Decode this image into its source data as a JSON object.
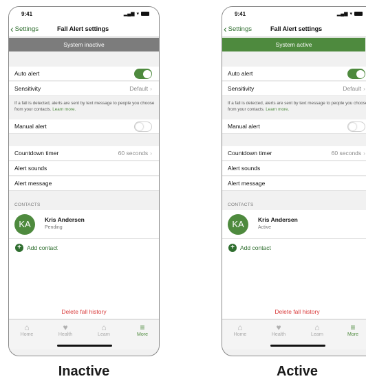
{
  "colors": {
    "accent": "#4e8a3e",
    "inactive_banner": "#7c7c7c",
    "danger": "#d93a3a"
  },
  "screens": [
    {
      "caption": "Inactive",
      "status_bar": {
        "time": "9:41",
        "signal": "▂▄▆",
        "wifi": "▾"
      },
      "nav": {
        "back_label": "Settings",
        "title": "Fall Alert settings"
      },
      "banner": {
        "text": "System inactive",
        "state": "inactive"
      },
      "auto_alert": {
        "label": "Auto alert",
        "enabled": true
      },
      "sensitivity": {
        "label": "Sensitivity",
        "value": "Default"
      },
      "info_text": "If a fall is detected, alerts are sent by text message to people you choose from your contacts.",
      "info_link": "Learn more.",
      "manual_alert": {
        "label": "Manual alert",
        "enabled": false
      },
      "countdown": {
        "label": "Countdown timer",
        "value": "60 seconds"
      },
      "alert_sounds": "Alert sounds",
      "alert_message": "Alert message",
      "contacts_header": "CONTACTS",
      "contact": {
        "initials": "KA",
        "name": "Kris Andersen",
        "status": "Pending"
      },
      "add_contact": "Add contact",
      "delete_history": "Delete fall history",
      "tabs": [
        {
          "label": "Home",
          "icon": "home-icon"
        },
        {
          "label": "Health",
          "icon": "heart-icon"
        },
        {
          "label": "Learn",
          "icon": "graduation-cap-icon"
        },
        {
          "label": "More",
          "icon": "menu-icon",
          "active": true
        }
      ]
    },
    {
      "caption": "Active",
      "status_bar": {
        "time": "9:41",
        "signal": "▂▄▆",
        "wifi": "▾"
      },
      "nav": {
        "back_label": "Settings",
        "title": "Fall Alert settings"
      },
      "banner": {
        "text": "System active",
        "state": "active"
      },
      "auto_alert": {
        "label": "Auto alert",
        "enabled": true
      },
      "sensitivity": {
        "label": "Sensitivity",
        "value": "Default"
      },
      "info_text": "If a fall is detected, alerts are sent by text message to people you choose from your contacts.",
      "info_link": "Learn more.",
      "manual_alert": {
        "label": "Manual alert",
        "enabled": false
      },
      "countdown": {
        "label": "Countdown timer",
        "value": "60 seconds"
      },
      "alert_sounds": "Alert sounds",
      "alert_message": "Alert message",
      "contacts_header": "CONTACTS",
      "contact": {
        "initials": "KA",
        "name": "Kris Andersen",
        "status": "Active"
      },
      "add_contact": "Add contact",
      "delete_history": "Delete fall history",
      "tabs": [
        {
          "label": "Home",
          "icon": "home-icon"
        },
        {
          "label": "Health",
          "icon": "heart-icon"
        },
        {
          "label": "Learn",
          "icon": "graduation-cap-icon"
        },
        {
          "label": "More",
          "icon": "menu-icon",
          "active": true
        }
      ]
    }
  ]
}
